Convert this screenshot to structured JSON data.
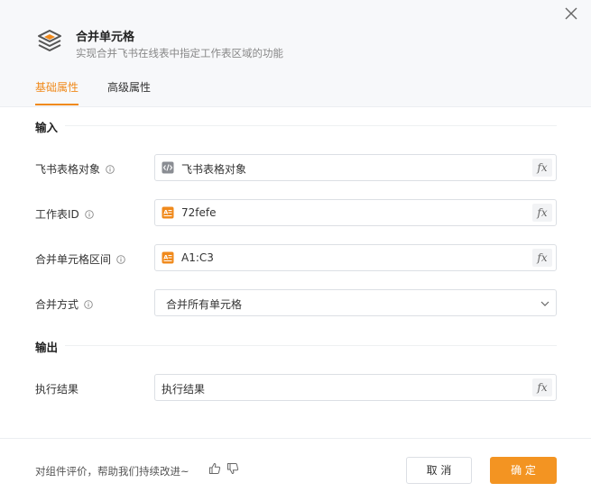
{
  "header": {
    "title": "合并单元格",
    "description": "实现合并飞书在线表中指定工作表区域的功能",
    "icon": "layers-icon"
  },
  "tabs": [
    {
      "label": "基础属性",
      "active": true
    },
    {
      "label": "高级属性",
      "active": false
    }
  ],
  "sections": {
    "input_title": "输入",
    "output_title": "输出"
  },
  "fields": {
    "sheet_object": {
      "label": "飞书表格对象",
      "value": "飞书表格对象",
      "icon": "code-icon"
    },
    "sheet_id": {
      "label": "工作表ID",
      "value": "72fefe",
      "icon": "text-var-icon"
    },
    "range": {
      "label": "合并单元格区间",
      "value": "A1:C3",
      "icon": "text-var-icon"
    },
    "merge_mode": {
      "label": "合并方式",
      "value": "合并所有单元格"
    },
    "result": {
      "label": "执行结果",
      "value": "执行结果"
    }
  },
  "fx_label": "fx",
  "footer": {
    "feedback": "对组件评价，帮助我们持续改进~",
    "cancel_label": "取 消",
    "ok_label": "确 定"
  },
  "colors": {
    "accent": "#f08a1c",
    "primary_button": "#f39422",
    "header_bg": "#f7f8fa"
  }
}
